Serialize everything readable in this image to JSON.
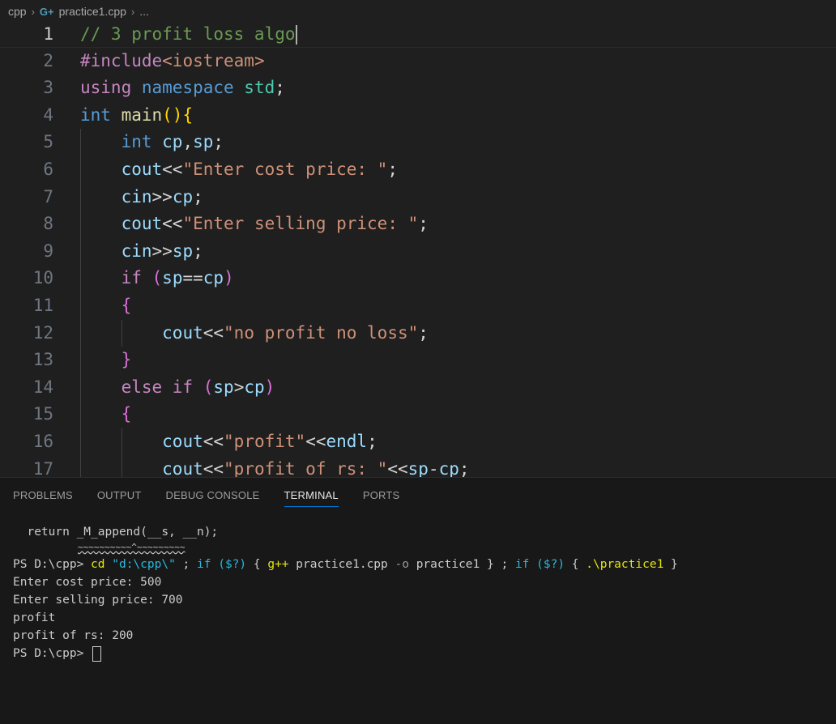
{
  "breadcrumb": {
    "folder": "cpp",
    "file_icon": "cpp-file-icon",
    "file": "practice1.cpp",
    "more": "..."
  },
  "editor": {
    "current_line": 1,
    "line_numbers": [
      "1",
      "2",
      "3",
      "4",
      "5",
      "6",
      "7",
      "8",
      "9",
      "10",
      "11",
      "12",
      "13",
      "14",
      "15",
      "16",
      "17"
    ],
    "lines": [
      [
        {
          "t": "comment",
          "v": "// 3 profit loss algo"
        }
      ],
      [
        {
          "t": "preproc",
          "v": "#include"
        },
        {
          "t": "include",
          "v": "<iostream>"
        }
      ],
      [
        {
          "t": "keyword",
          "v": "using "
        },
        {
          "t": "type",
          "v": "namespace "
        },
        {
          "t": "ns",
          "v": "std"
        },
        {
          "t": "plain",
          "v": ";"
        }
      ],
      [
        {
          "t": "type",
          "v": "int "
        },
        {
          "t": "func",
          "v": "main"
        },
        {
          "t": "brace1",
          "v": "(){"
        }
      ],
      [
        {
          "t": "plain",
          "v": "    "
        },
        {
          "t": "type",
          "v": "int "
        },
        {
          "t": "var",
          "v": "cp"
        },
        {
          "t": "plain",
          "v": ","
        },
        {
          "t": "var",
          "v": "sp"
        },
        {
          "t": "plain",
          "v": ";"
        }
      ],
      [
        {
          "t": "plain",
          "v": "    "
        },
        {
          "t": "var",
          "v": "cout"
        },
        {
          "t": "plain",
          "v": "<<"
        },
        {
          "t": "string",
          "v": "\"Enter cost price: \""
        },
        {
          "t": "plain",
          "v": ";"
        }
      ],
      [
        {
          "t": "plain",
          "v": "    "
        },
        {
          "t": "var",
          "v": "cin"
        },
        {
          "t": "plain",
          "v": ">>"
        },
        {
          "t": "var",
          "v": "cp"
        },
        {
          "t": "plain",
          "v": ";"
        }
      ],
      [
        {
          "t": "plain",
          "v": "    "
        },
        {
          "t": "var",
          "v": "cout"
        },
        {
          "t": "plain",
          "v": "<<"
        },
        {
          "t": "string",
          "v": "\"Enter selling price: \""
        },
        {
          "t": "plain",
          "v": ";"
        }
      ],
      [
        {
          "t": "plain",
          "v": "    "
        },
        {
          "t": "var",
          "v": "cin"
        },
        {
          "t": "plain",
          "v": ">>"
        },
        {
          "t": "var",
          "v": "sp"
        },
        {
          "t": "plain",
          "v": ";"
        }
      ],
      [
        {
          "t": "plain",
          "v": "    "
        },
        {
          "t": "keyword",
          "v": "if "
        },
        {
          "t": "brace2",
          "v": "("
        },
        {
          "t": "var",
          "v": "sp"
        },
        {
          "t": "plain",
          "v": "=="
        },
        {
          "t": "var",
          "v": "cp"
        },
        {
          "t": "brace2",
          "v": ")"
        }
      ],
      [
        {
          "t": "plain",
          "v": "    "
        },
        {
          "t": "brace2",
          "v": "{"
        }
      ],
      [
        {
          "t": "plain",
          "v": "        "
        },
        {
          "t": "var",
          "v": "cout"
        },
        {
          "t": "plain",
          "v": "<<"
        },
        {
          "t": "string",
          "v": "\"no profit no loss\""
        },
        {
          "t": "plain",
          "v": ";"
        }
      ],
      [
        {
          "t": "plain",
          "v": "    "
        },
        {
          "t": "brace2",
          "v": "}"
        }
      ],
      [
        {
          "t": "plain",
          "v": "    "
        },
        {
          "t": "keyword",
          "v": "else if "
        },
        {
          "t": "brace2",
          "v": "("
        },
        {
          "t": "var",
          "v": "sp"
        },
        {
          "t": "plain",
          "v": ">"
        },
        {
          "t": "var",
          "v": "cp"
        },
        {
          "t": "brace2",
          "v": ")"
        }
      ],
      [
        {
          "t": "plain",
          "v": "    "
        },
        {
          "t": "brace2",
          "v": "{"
        }
      ],
      [
        {
          "t": "plain",
          "v": "        "
        },
        {
          "t": "var",
          "v": "cout"
        },
        {
          "t": "plain",
          "v": "<<"
        },
        {
          "t": "string",
          "v": "\"profit\""
        },
        {
          "t": "plain",
          "v": "<<"
        },
        {
          "t": "var",
          "v": "endl"
        },
        {
          "t": "plain",
          "v": ";"
        }
      ],
      [
        {
          "t": "plain",
          "v": "        "
        },
        {
          "t": "var",
          "v": "cout"
        },
        {
          "t": "plain",
          "v": "<<"
        },
        {
          "t": "string",
          "v": "\"profit of rs: \""
        },
        {
          "t": "plain",
          "v": "<<"
        },
        {
          "t": "var",
          "v": "sp"
        },
        {
          "t": "plain",
          "v": "-"
        },
        {
          "t": "var",
          "v": "cp"
        },
        {
          "t": "plain",
          "v": ";"
        }
      ]
    ]
  },
  "panel": {
    "tabs": [
      "PROBLEMS",
      "OUTPUT",
      "DEBUG CONSOLE",
      "TERMINAL",
      "PORTS"
    ],
    "active_tab": "TERMINAL",
    "terminal": {
      "error_line": "  return _M_append(__s, __n);",
      "error_squiggle": "~~~~~~~~~~^~~~~~~~~~",
      "prompt": "PS D:\\cpp> ",
      "cmd_cd": "cd ",
      "cmd_path": "\"d:\\cpp\\\"",
      "cmd_sep1": " ; ",
      "cmd_if1": "if ",
      "cmd_cond1": "($?)",
      "cmd_open1": " { ",
      "cmd_gpp": "g++ ",
      "cmd_gpp_args1": "practice1.cpp ",
      "cmd_gpp_flag": "-o ",
      "cmd_gpp_args2": "practice1",
      "cmd_close1": " } ",
      "cmd_sep2": "; ",
      "cmd_if2": "if ",
      "cmd_cond2": "($?)",
      "cmd_open2": " { ",
      "cmd_run": ".\\practice1",
      "cmd_close2": " }",
      "output": [
        "Enter cost price: 500",
        "Enter selling price: 700",
        "profit",
        "profit of rs: 200"
      ],
      "final_prompt": "PS D:\\cpp> "
    }
  },
  "colors": {
    "background": "#1f1f1f",
    "panel_background": "#181818",
    "active_tab_underline": "#0078d4"
  }
}
